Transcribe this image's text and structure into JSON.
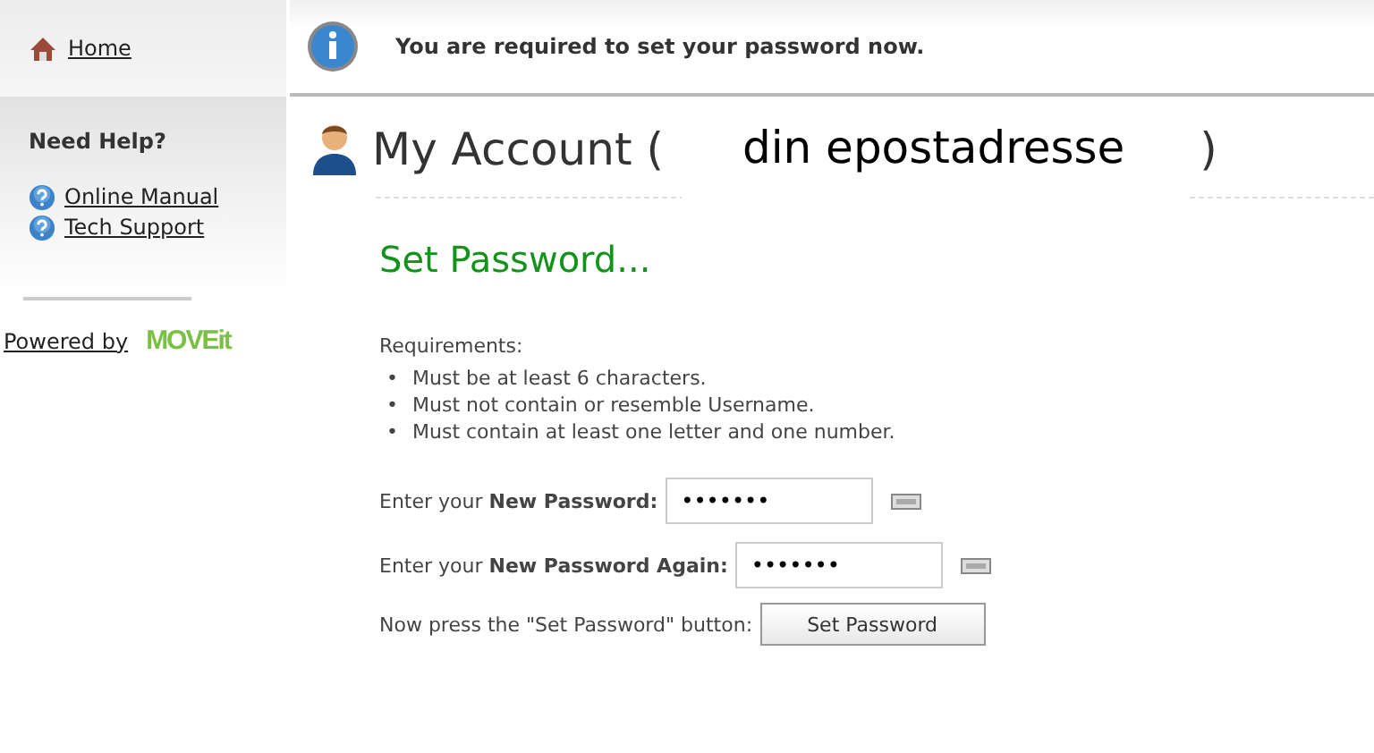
{
  "sidebar": {
    "home_link": "Home",
    "help_heading": "Need Help?",
    "help_links": [
      "Online Manual",
      "Tech Support"
    ],
    "powered_by": "Powered by",
    "brand": "MOVEit"
  },
  "notice": "You are required to set your password now.",
  "account": {
    "title_prefix": "My Account (",
    "overlay": "din epostadresse",
    "title_suffix": ")"
  },
  "heading": "Set Password...",
  "requirements": {
    "label": "Requirements:",
    "bullet": "•",
    "items": [
      "Must be at least 6 characters.",
      "Must not contain or resemble Username.",
      "Must contain at least one letter and one number."
    ]
  },
  "fields": [
    {
      "label": "Enter your **New Password:**",
      "value": "•••••••"
    },
    {
      "label": "Enter your **New Password Again:**",
      "value": "•••••••"
    }
  ],
  "submit": {
    "label": "Now press the \"Set Password\" button:",
    "button": "Set Password"
  }
}
